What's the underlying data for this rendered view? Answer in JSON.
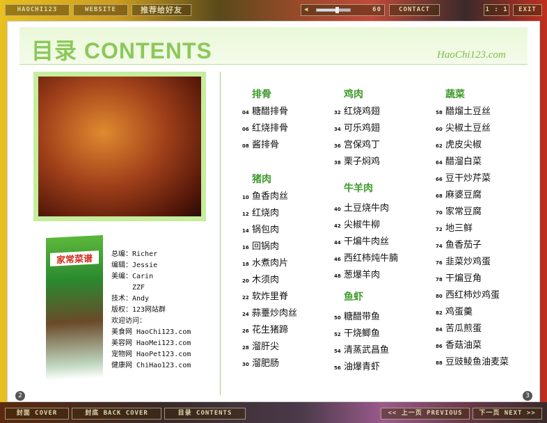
{
  "topbar": {
    "haochi": "HAOCHI123",
    "website": "WEBSITE",
    "recommend": "推荐给好友",
    "volume": "60",
    "volume_level": 0.6,
    "contact": "CONTACT",
    "ratio": "1 : 1",
    "exit": "EXIT"
  },
  "bottombar": {
    "cover": "封面 COVER",
    "back_cover": "封底 BACK COVER",
    "contents": "目录 CONTENTS",
    "previous": "<< 上一页 PREVIOUS",
    "next": "下一页 NEXT >>"
  },
  "header": {
    "title": "目录 CONTENTS",
    "site": "HaoChi123.com"
  },
  "book": {
    "title": "家常菜谱"
  },
  "credits": [
    "总编：Richer",
    "编辑：Jessie",
    "美编：Carin",
    "　　　ZZF",
    "技术：Andy",
    "版权：123网站群",
    "欢迎访问：",
    "美食网 HaoChi123.com",
    "美容网 HaoMei123.com",
    "宠物网 HaoPet123.com",
    "健康网 ChiHao123.com"
  ],
  "sections": [
    {
      "title": "排骨",
      "items": [
        [
          "04",
          "糖醋排骨"
        ],
        [
          "06",
          "红烧排骨"
        ],
        [
          "08",
          "酱排骨"
        ]
      ]
    },
    {
      "title": "猪肉",
      "items": [
        [
          "10",
          "鱼香肉丝"
        ],
        [
          "12",
          "红烧肉"
        ],
        [
          "14",
          "锅包肉"
        ],
        [
          "16",
          "回锅肉"
        ],
        [
          "18",
          "水煮肉片"
        ],
        [
          "20",
          "木须肉"
        ],
        [
          "22",
          "软炸里脊"
        ],
        [
          "24",
          "蒜薹炒肉丝"
        ],
        [
          "26",
          "花生猪蹄"
        ],
        [
          "28",
          "溜肝尖"
        ],
        [
          "30",
          "溜肥肠"
        ]
      ]
    },
    {
      "title": "鸡肉",
      "items": [
        [
          "32",
          "红烧鸡翅"
        ],
        [
          "34",
          "可乐鸡翅"
        ],
        [
          "36",
          "宫保鸡丁"
        ],
        [
          "38",
          "栗子焖鸡"
        ]
      ]
    },
    {
      "title": "牛羊肉",
      "items": [
        [
          "40",
          "土豆烧牛肉"
        ],
        [
          "42",
          "尖椒牛柳"
        ],
        [
          "44",
          "干煸牛肉丝"
        ],
        [
          "46",
          "西红柿炖牛腩"
        ],
        [
          "48",
          "葱爆羊肉"
        ]
      ]
    },
    {
      "title": "鱼虾",
      "items": [
        [
          "50",
          "糖醋带鱼"
        ],
        [
          "52",
          "干烧鲫鱼"
        ],
        [
          "54",
          "清蒸武昌鱼"
        ],
        [
          "56",
          "油爆青虾"
        ]
      ]
    },
    {
      "title": "蔬菜",
      "items": [
        [
          "58",
          "醋熘土豆丝"
        ],
        [
          "60",
          "尖椒土豆丝"
        ],
        [
          "62",
          "虎皮尖椒"
        ],
        [
          "64",
          "醋溜白菜"
        ],
        [
          "66",
          "豆干炒芹菜"
        ],
        [
          "68",
          "麻婆豆腐"
        ],
        [
          "70",
          "家常豆腐"
        ],
        [
          "72",
          "地三鲜"
        ],
        [
          "74",
          "鱼香茄子"
        ],
        [
          "76",
          "韭菜炒鸡蛋"
        ],
        [
          "78",
          "干煸豆角"
        ],
        [
          "80",
          "西红柿炒鸡蛋"
        ],
        [
          "82",
          "鸡蛋羹"
        ],
        [
          "84",
          "苦瓜煎蛋"
        ],
        [
          "86",
          "香菇油菜"
        ],
        [
          "88",
          "豆豉鲮鱼油麦菜"
        ]
      ]
    }
  ],
  "page_numbers": {
    "left": "2",
    "right": "3"
  }
}
